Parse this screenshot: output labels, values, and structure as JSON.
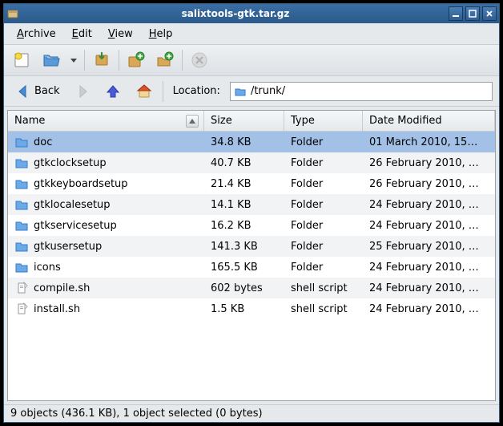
{
  "window": {
    "title": "salixtools-gtk.tar.gz"
  },
  "menus": {
    "archive": "Archive",
    "edit": "Edit",
    "view": "View",
    "help": "Help"
  },
  "nav": {
    "back": "Back",
    "location_label": "Location:"
  },
  "location": {
    "path": "/trunk/"
  },
  "columns": {
    "name": "Name",
    "size": "Size",
    "type": "Type",
    "date": "Date Modified"
  },
  "files": [
    {
      "name": "doc",
      "size": "34.8 KB",
      "type": "Folder",
      "date": "01 March 2010, 15…",
      "icon": "folder",
      "selected": true
    },
    {
      "name": "gtkclocksetup",
      "size": "40.7 KB",
      "type": "Folder",
      "date": "26 February 2010, …",
      "icon": "folder"
    },
    {
      "name": "gtkkeyboardsetup",
      "size": "21.4 KB",
      "type": "Folder",
      "date": "26 February 2010, …",
      "icon": "folder"
    },
    {
      "name": "gtklocalesetup",
      "size": "14.1 KB",
      "type": "Folder",
      "date": "24 February 2010, …",
      "icon": "folder"
    },
    {
      "name": "gtkservicesetup",
      "size": "16.2 KB",
      "type": "Folder",
      "date": "24 February 2010, …",
      "icon": "folder"
    },
    {
      "name": "gtkusersetup",
      "size": "141.3 KB",
      "type": "Folder",
      "date": "25 February 2010, …",
      "icon": "folder"
    },
    {
      "name": "icons",
      "size": "165.5 KB",
      "type": "Folder",
      "date": "24 February 2010, …",
      "icon": "folder"
    },
    {
      "name": "compile.sh",
      "size": "602 bytes",
      "type": "shell script",
      "date": "24 February 2010, …",
      "icon": "script"
    },
    {
      "name": "install.sh",
      "size": "1.5 KB",
      "type": "shell script",
      "date": "24 February 2010, …",
      "icon": "script"
    }
  ],
  "status": "9 objects (436.1 KB), 1 object selected (0 bytes)"
}
